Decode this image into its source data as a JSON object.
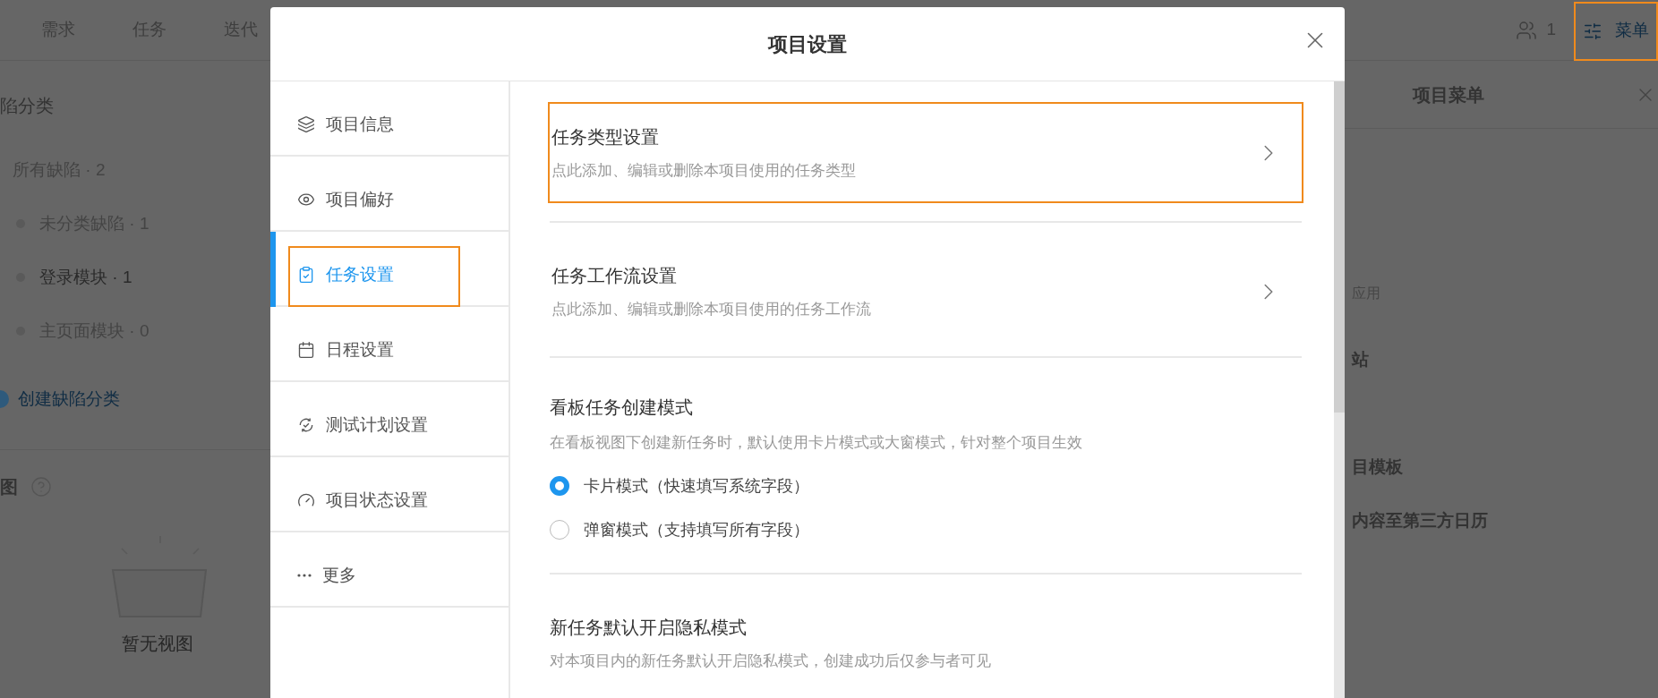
{
  "page": {
    "nav_tabs": [
      {
        "label": "需求"
      },
      {
        "label": "任务"
      },
      {
        "label": "迭代"
      }
    ],
    "member_count": "1",
    "menu_button": {
      "label": "菜单",
      "highlighted": true
    },
    "categories": {
      "title": "陷分类",
      "all": "所有缺陷 · 2",
      "items": [
        {
          "label": "未分类缺陷 · 1",
          "selected": false
        },
        {
          "label": "登录模块 · 1",
          "selected": true
        },
        {
          "label": "主页面模块 · 0",
          "selected": false
        }
      ],
      "create_link": "创建缺陷分类"
    },
    "views": {
      "title": "图",
      "empty_text": "暂无视图"
    },
    "project_menu": {
      "title": "项目菜单",
      "items": [
        {
          "label": "应用",
          "kind": "note"
        },
        {
          "label": "站",
          "kind": "item"
        },
        {
          "label": "目模板",
          "kind": "item"
        },
        {
          "label": "内容至第三方日历",
          "kind": "item"
        }
      ]
    }
  },
  "dialog": {
    "title": "项目设置",
    "nav": [
      {
        "label": "项目信息",
        "selected": false,
        "highlighted": false
      },
      {
        "label": "项目偏好",
        "selected": false,
        "highlighted": false
      },
      {
        "label": "任务设置",
        "selected": true,
        "highlighted": true
      },
      {
        "label": "日程设置",
        "selected": false,
        "highlighted": false
      },
      {
        "label": "测试计划设置",
        "selected": false,
        "highlighted": false
      },
      {
        "label": "项目状态设置",
        "selected": false,
        "highlighted": false
      },
      {
        "label": "更多",
        "selected": false,
        "highlighted": false
      }
    ],
    "sections": [
      {
        "kind": "link",
        "title": "任务类型设置",
        "description": "点此添加、编辑或删除本项目使用的任务类型",
        "highlighted": true
      },
      {
        "kind": "link",
        "title": "任务工作流设置",
        "description": "点此添加、编辑或删除本项目使用的任务工作流",
        "highlighted": false
      },
      {
        "kind": "radio",
        "title": "看板任务创建模式",
        "description": "在看板视图下创建新任务时，默认使用卡片模式或大窗模式，针对整个项目生效",
        "options": [
          {
            "label": "卡片模式（快速填写系统字段）",
            "selected": true
          },
          {
            "label": "弹窗模式（支持填写所有字段）",
            "selected": false
          }
        ]
      },
      {
        "kind": "text",
        "title": "新任务默认开启隐私模式",
        "description": "对本项目内的新任务默认开启隐私模式，创建成功后仅参与者可见"
      }
    ]
  }
}
